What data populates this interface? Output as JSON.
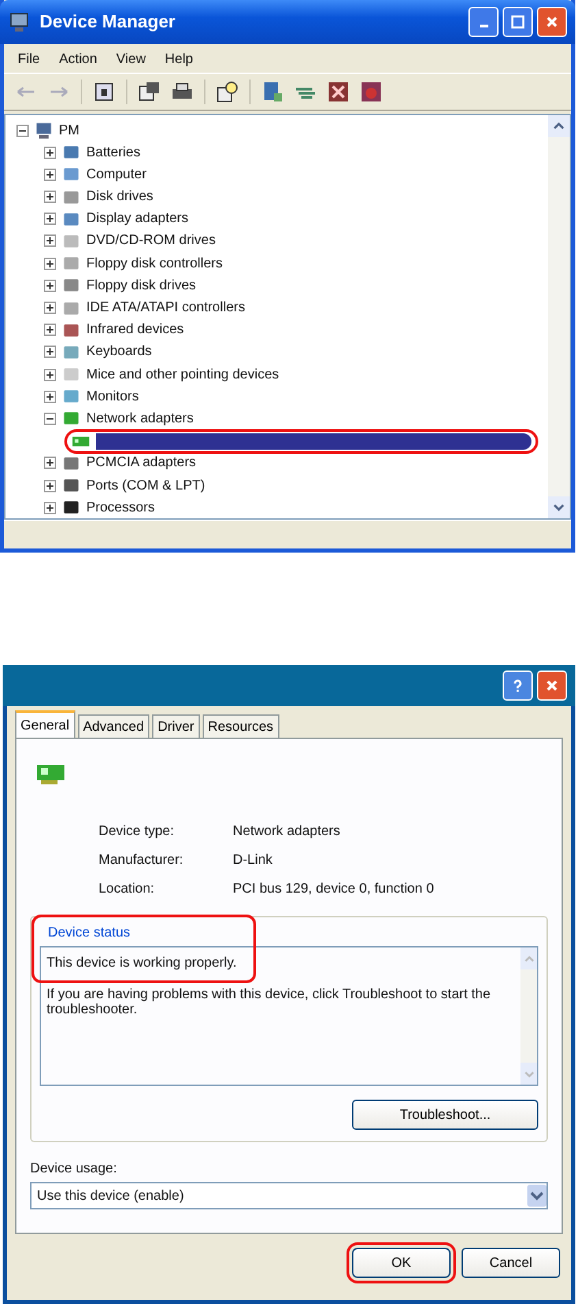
{
  "device_manager": {
    "title": "Device Manager",
    "menu": [
      "File",
      "Action",
      "View",
      "Help"
    ],
    "tree": {
      "label": "PM",
      "expanded": true,
      "children": [
        {
          "label": "Batteries",
          "expanded": false
        },
        {
          "label": "Computer",
          "expanded": false
        },
        {
          "label": "Disk drives",
          "expanded": false
        },
        {
          "label": "Display adapters",
          "expanded": false
        },
        {
          "label": "DVD/CD-ROM drives",
          "expanded": false
        },
        {
          "label": "Floppy disk controllers",
          "expanded": false
        },
        {
          "label": "Floppy disk drives",
          "expanded": false
        },
        {
          "label": "IDE ATA/ATAPI controllers",
          "expanded": false
        },
        {
          "label": "Infrared devices",
          "expanded": false
        },
        {
          "label": "Keyboards",
          "expanded": false
        },
        {
          "label": "Mice and other pointing devices",
          "expanded": false
        },
        {
          "label": "Monitors",
          "expanded": false
        },
        {
          "label": "Network adapters",
          "expanded": true,
          "children": [
            {
              "selected": true,
              "highlighted": true
            }
          ]
        },
        {
          "label": "PCMCIA adapters",
          "expanded": false
        },
        {
          "label": "Ports (COM & LPT)",
          "expanded": false
        },
        {
          "label": "Processors",
          "expanded": false
        }
      ]
    }
  },
  "properties": {
    "tabs": [
      {
        "label": "General",
        "selected": true
      },
      {
        "label": "Advanced",
        "selected": false
      },
      {
        "label": "Driver",
        "selected": false
      },
      {
        "label": "Resources",
        "selected": false
      }
    ],
    "fields": [
      {
        "label": "Device type:",
        "value": "Network adapters"
      },
      {
        "label": "Manufacturer:",
        "value": "D-Link"
      },
      {
        "label": "Location:",
        "value": "PCI bus 129, device 0, function 0"
      }
    ],
    "device_status": {
      "label": "Device status",
      "message": "This device is working properly.",
      "detail": "If you are having problems with this device, click Troubleshoot to start the troubleshooter.",
      "highlighted": true
    },
    "troubleshoot_button": "Troubleshoot...",
    "device_usage": {
      "label": "Device usage:",
      "value": "Use this device (enable)"
    },
    "buttons": [
      {
        "label": "OK",
        "highlighted": true
      },
      {
        "label": "Cancel",
        "highlighted": false
      }
    ]
  }
}
